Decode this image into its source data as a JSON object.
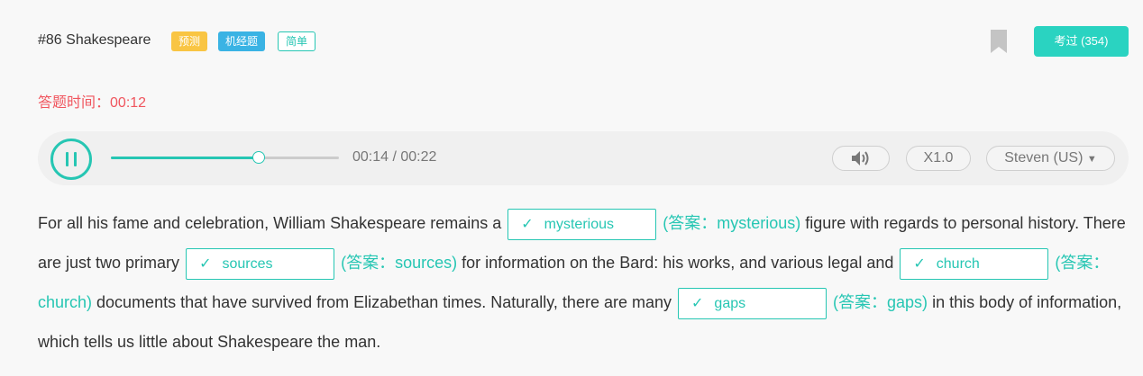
{
  "header": {
    "title": "#86 Shakespeare",
    "badges": [
      "预测",
      "机经题",
      "简单"
    ],
    "done_button": "考过 (354)"
  },
  "timer": {
    "label": "答题时间：",
    "value": "00:12"
  },
  "player": {
    "progress": 0.65,
    "time_display": "00:14 / 00:22",
    "speed": "X1.0",
    "voice": "Steven (US)"
  },
  "passage": {
    "t1": "For all his fame and celebration, William Shakespeare remains a",
    "b1": {
      "check": "✓",
      "value": "mysterious"
    },
    "a1": "(答案：mysterious)",
    "t2": " figure with regards to personal history. There are just two primary",
    "b2": {
      "check": "✓",
      "value": "sources"
    },
    "a2": "(答案：sources)",
    "t3": " for information on the Bard: his works, and various legal and",
    "b3": {
      "check": "✓",
      "value": "church"
    },
    "a3": "(答案：church)",
    "t4": " documents that have survived from Elizabethan times. Naturally, there are many",
    "b4": {
      "check": "✓",
      "value": "gaps"
    },
    "a4": "(答案：gaps)",
    "t5": " in this body of information, which tells us little about Shakespeare the man."
  },
  "colors": {
    "accent": "#26c6b3",
    "timer": "#f0555e",
    "badge_predict": "#f9c543",
    "badge_jijing": "#3ab3e4"
  },
  "icons": [
    "bookmark-icon",
    "pause-icon",
    "volume-icon",
    "caret-down-icon",
    "check-icon"
  ]
}
